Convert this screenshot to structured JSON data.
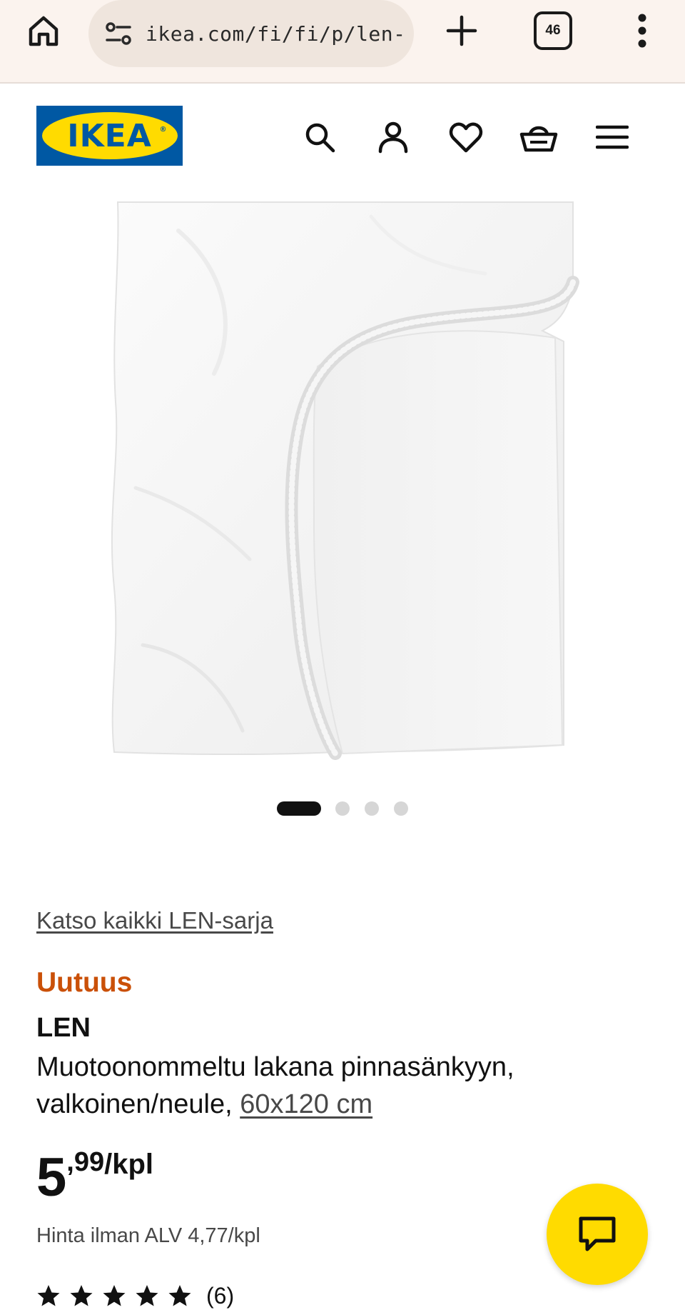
{
  "browser": {
    "url": "ikea.com/fi/fi/p/len-mu",
    "tab_count": "46"
  },
  "site": {
    "logo_text": "IKEA",
    "logo_colors": {
      "blue": "#0058a3",
      "yellow": "#ffdb00"
    },
    "header_icons": [
      "search-icon",
      "account-icon",
      "favorites-heart-icon",
      "shopping-basket-icon",
      "menu-icon"
    ]
  },
  "carousel": {
    "total_images": 4,
    "active_index": 0
  },
  "product": {
    "series_link": "Katso kaikki LEN-sarja",
    "badge": "Uutuus",
    "name": "LEN",
    "description": "Muotoonommeltu lakana pinnasänkyyn, valkoinen/neule,",
    "size_link": "60x120 cm",
    "price_integer": "5",
    "price_decimal": ",99",
    "price_unit": "/kpl",
    "price_excl_vat": "Hinta ilman ALV 4,77/kpl",
    "rating_stars": 5,
    "rating_count": "(6)"
  },
  "colors": {
    "badge_orange": "#ca5008",
    "chat_button_yellow": "#ffdb00"
  }
}
